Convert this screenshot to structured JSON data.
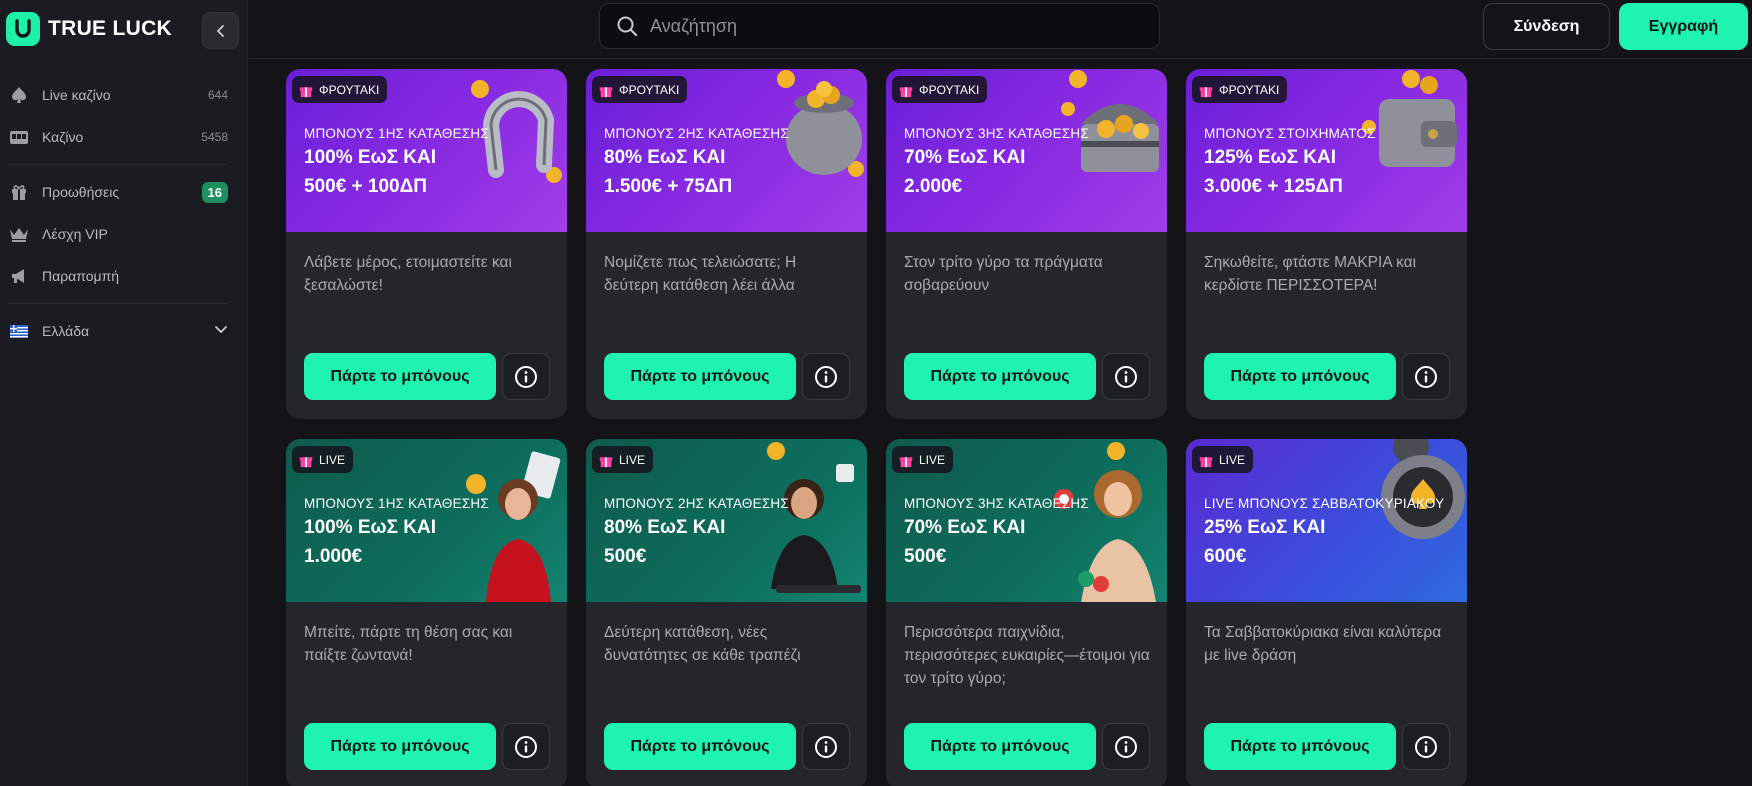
{
  "brand": {
    "name": "TRUE LUCK",
    "accent": "#1ff3b0"
  },
  "sidebar": {
    "items": [
      {
        "label": "Live καζίνο",
        "count": "644",
        "icon": "spade-icon"
      },
      {
        "label": "Καζίνο",
        "count": "5458",
        "icon": "slot-machine-icon"
      },
      {
        "label": "Προωθήσεις",
        "badge": "16",
        "icon": "gift-icon"
      },
      {
        "label": "Λέσχη VIP",
        "icon": "crown-icon"
      },
      {
        "label": "Παραπομπή",
        "icon": "megaphone-icon"
      }
    ],
    "country": {
      "label": "Ελλάδα",
      "icon": "greece-flag-icon"
    }
  },
  "header": {
    "search_placeholder": "Αναζήτηση",
    "login_label": "Σύνδεση",
    "register_label": "Εγγραφή"
  },
  "cards": [
    {
      "tag": "ΦΡΟΥΤΑΚΙ",
      "subtitle": "ΜΠΟΝΟΥΣ 1ΗΣ ΚΑΤΑΘΕΣΗΣ",
      "line1": "100% ΕωΣ ΚΑΙ",
      "line2": "500€ + 100ΔΠ",
      "description": "Λάβετε μέρος, ετοιμαστείτε και ξεσαλώστε!",
      "claim": "Πάρτε το μπόνους",
      "art": "horseshoe"
    },
    {
      "tag": "ΦΡΟΥΤΑΚΙ",
      "subtitle": "ΜΠΟΝΟΥΣ 2ΗΣ ΚΑΤΑΘΕΣΗΣ",
      "line1": "80% ΕωΣ ΚΑΙ",
      "line2": "1.500€ + 75ΔΠ",
      "description": "Νομίζετε πως τελειώσατε; Η δεύτερη κατάθεση λέει άλλα",
      "claim": "Πάρτε το μπόνους",
      "art": "coin-pot"
    },
    {
      "tag": "ΦΡΟΥΤΑΚΙ",
      "subtitle": "ΜΠΟΝΟΥΣ 3ΗΣ ΚΑΤΑΘΕΣΗΣ",
      "line1": "70% ΕωΣ ΚΑΙ",
      "line2": "2.000€",
      "description": "Στον τρίτο γύρο τα πράγματα σοβαρεύουν",
      "claim": "Πάρτε το μπόνους",
      "art": "treasure-chest"
    },
    {
      "tag": "ΦΡΟΥΤΑΚΙ",
      "subtitle": "ΜΠΟΝΟΥΣ ΣΤΟΙΧΗΜΑΤΟΣ",
      "line1": "125% ΕωΣ ΚΑΙ",
      "line2": "3.000€ + 125ΔΠ",
      "description": "Σηκωθείτε, φτάστε ΜΑΚΡΙΑ και κερδίστε ΠΕΡΙΣΣΟΤΕΡΑ!",
      "claim": "Πάρτε το μπόνους",
      "art": "wallet"
    },
    {
      "tag": "LIVE",
      "subtitle": "ΜΠΟΝΟΥΣ 1ΗΣ ΚΑΤΑΘΕΣΗΣ",
      "line1": "100% ΕωΣ ΚΑΙ",
      "line2": "1.000€",
      "description": "Μπείτε, πάρτε τη θέση σας και παίξτε ζωντανά!",
      "claim": "Πάρτε το μπόνους",
      "art": "dealer"
    },
    {
      "tag": "LIVE",
      "subtitle": "ΜΠΟΝΟΥΣ 2ΗΣ ΚΑΤΑΘΕΣΗΣ",
      "line1": "80% ΕωΣ ΚΑΙ",
      "line2": "500€",
      "description": "Δεύτερη κατάθεση, νέες δυνατότητες σε κάθε τραπέζι",
      "claim": "Πάρτε το μπόνους",
      "art": "dealer"
    },
    {
      "tag": "LIVE",
      "subtitle": "ΜΠΟΝΟΥΣ 3ΗΣ ΚΑΤΑΘΕΣΗΣ",
      "line1": "70% ΕωΣ ΚΑΙ",
      "line2": "500€",
      "description": "Περισσότερα παιχνίδια, περισσότερες ευκαιρίες—έτοιμοι για τον τρίτο γύρο;",
      "claim": "Πάρτε το μπόνους",
      "art": "dealer"
    },
    {
      "tag": "LIVE",
      "subtitle": "LIVE ΜΠΟΝΟΥΣ ΣΑΒΒΑΤΟΚΥΡΙΑΚΟΥ",
      "line1": "25% ΕωΣ ΚΑΙ",
      "line2": "600€",
      "description": "Τα Σαββατοκύριακα είναι καλύτερα με live δράση",
      "claim": "Πάρτε το μπόνους",
      "art": "casino-chip"
    }
  ]
}
